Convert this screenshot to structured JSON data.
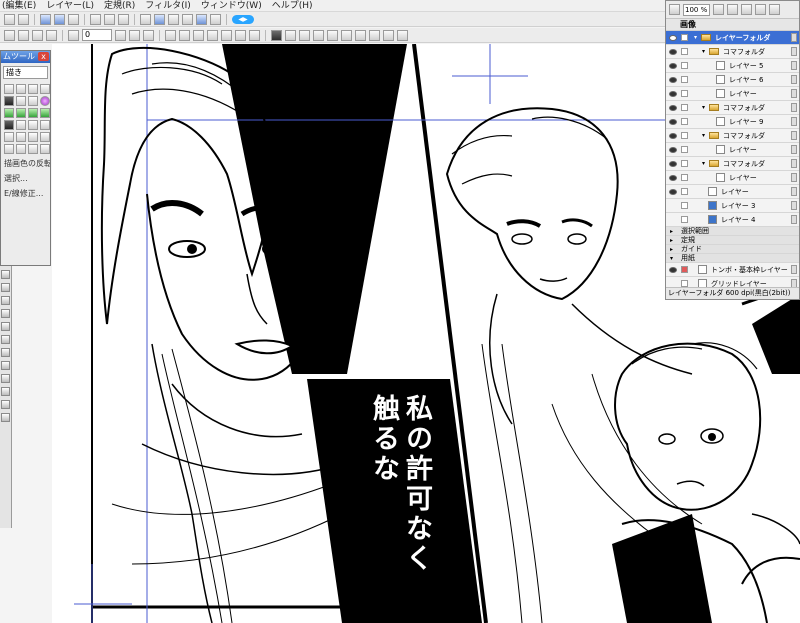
{
  "menubar": {
    "items": [
      "(編集(E)",
      "レイヤー(L)",
      "定規(R)",
      "フィルタ(I)",
      "ウィンドウ(W)",
      "ヘルプ(H)"
    ]
  },
  "toolbar": {
    "rotation_value": "0",
    "pill_label": "◀▶"
  },
  "tool_panel": {
    "title": "ムツール",
    "close_label": "x",
    "brush_name": "描き",
    "options": [
      "描画色の反転",
      "選択...",
      "E/線修正..."
    ]
  },
  "canvas": {
    "caption_columns": [
      "私の許可なく",
      "触るな"
    ],
    "caption_bg": "#000000"
  },
  "layers": {
    "zoom": "100 %",
    "header": "画像",
    "rows": [
      {
        "name": "レイヤーフォルダ",
        "type": "folder",
        "selected": true,
        "indent": 0
      },
      {
        "name": "コマフォルダ",
        "type": "folder",
        "indent": 1
      },
      {
        "name": "レイヤー 5",
        "type": "layer",
        "indent": 2
      },
      {
        "name": "レイヤー 6",
        "type": "layer",
        "indent": 2
      },
      {
        "name": "レイヤー",
        "type": "layer",
        "indent": 2
      },
      {
        "name": "コマフォルダ",
        "type": "folder",
        "indent": 1
      },
      {
        "name": "レイヤー 9",
        "type": "layer",
        "indent": 2
      },
      {
        "name": "コマフォルダ",
        "type": "folder",
        "indent": 1
      },
      {
        "name": "レイヤー",
        "type": "layer",
        "indent": 2
      },
      {
        "name": "コマフォルダ",
        "type": "folder",
        "indent": 1
      },
      {
        "name": "レイヤー",
        "type": "layer",
        "indent": 2
      },
      {
        "name": "レイヤー",
        "type": "layer",
        "indent": 1
      },
      {
        "name": "レイヤー 3",
        "type": "layer",
        "indent": 1
      },
      {
        "name": "レイヤー 4",
        "type": "layer",
        "indent": 1
      }
    ],
    "sections": [
      "選択範囲",
      "定規",
      "ガイド",
      "用紙"
    ],
    "bottom_rows": [
      "トンボ・基本枠レイヤー",
      "グリッドレイヤー"
    ],
    "status": "レイヤーフォルダ 600 dpi(黒白(2bit))",
    "accent": "#3b6fd4"
  }
}
